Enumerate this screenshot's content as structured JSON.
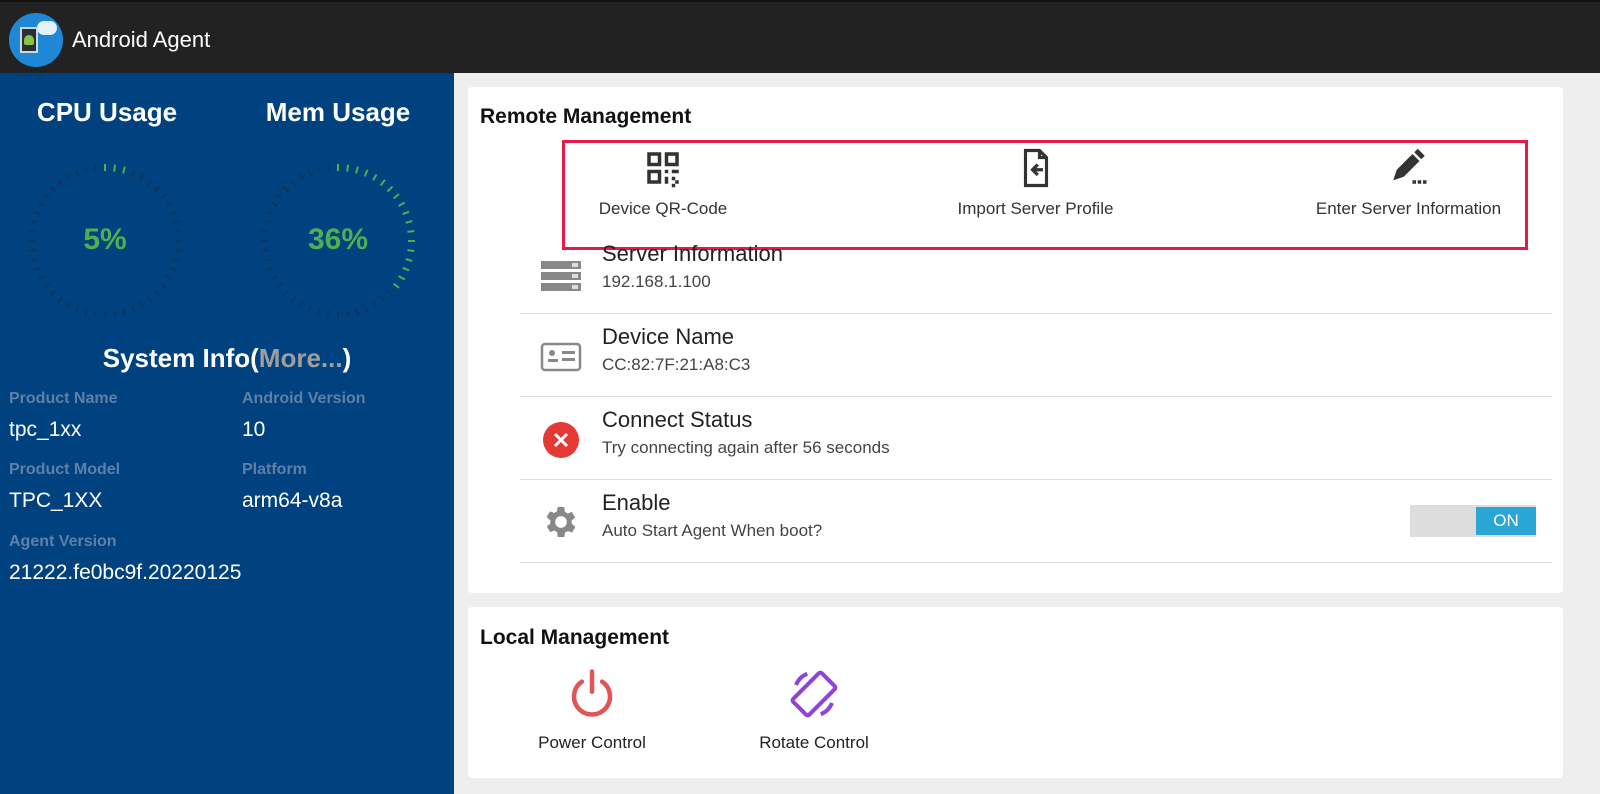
{
  "app": {
    "title": "Android Agent"
  },
  "gauges": [
    {
      "title": "CPU Usage",
      "value": "5%",
      "percent": 5
    },
    {
      "title": "Mem Usage",
      "value": "36%",
      "percent": 36
    }
  ],
  "colors": {
    "accent": "#4caf50",
    "panel": "#00427f",
    "highlight": "#e8194a",
    "toggle": "#2aa6d5",
    "error": "#e53935",
    "power": "#e05555",
    "rotate": "#8e44d9"
  },
  "system_info": {
    "title": "System Info(",
    "more": "More...",
    "close": ")",
    "fields": [
      {
        "label": "Product Name",
        "value": "tpc_1xx"
      },
      {
        "label": "Android Version",
        "value": "10"
      },
      {
        "label": "Product Model",
        "value": "TPC_1XX"
      },
      {
        "label": "Platform",
        "value": "arm64-v8a"
      },
      {
        "label": "Agent Version",
        "value": "21222.fe0bc9f.20220125"
      }
    ]
  },
  "remote": {
    "title": "Remote Management",
    "actions": [
      {
        "label": "Device QR-Code",
        "icon": "qr-code-icon"
      },
      {
        "label": "Import Server Profile",
        "icon": "file-import-icon"
      },
      {
        "label": "Enter Server Information",
        "icon": "pencil-icon"
      }
    ],
    "rows": [
      {
        "title": "Server Information",
        "sub": "192.168.1.100"
      },
      {
        "title": "Device Name",
        "sub": "CC:82:7F:21:A8:C3"
      },
      {
        "title": "Connect Status",
        "sub": "Try connecting again after 56 seconds"
      },
      {
        "title": "Enable",
        "sub": "Auto Start Agent When boot?"
      }
    ],
    "toggle": "ON"
  },
  "local": {
    "title": "Local Management",
    "actions": [
      {
        "label": "Power Control"
      },
      {
        "label": "Rotate Control"
      }
    ]
  }
}
